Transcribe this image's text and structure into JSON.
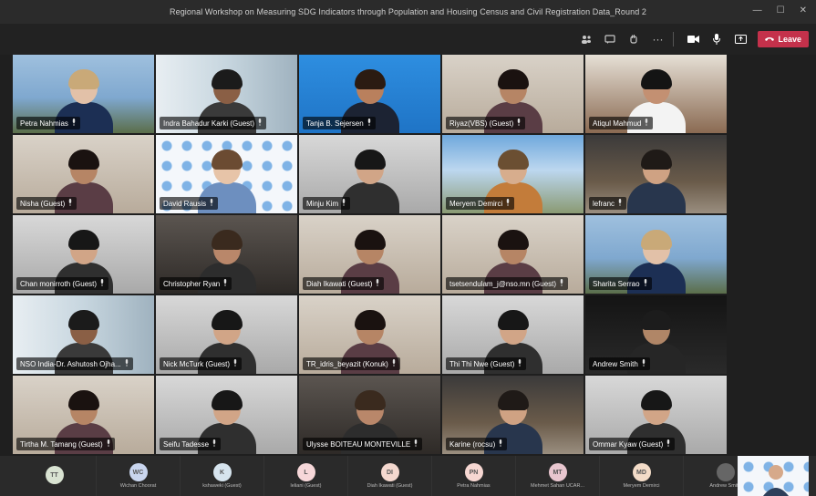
{
  "window": {
    "title": "Regional Workshop on Measuring SDG Indicators through Population and Housing Census and Civil Registration Data_Round 2",
    "minimize": "—",
    "maximize": "☐",
    "close": "✕"
  },
  "toolbar": {
    "leave_label": "Leave",
    "more": "···"
  },
  "tiles": [
    {
      "name": "Petra Nahmias",
      "theme": "escap"
    },
    {
      "name": "Indra Bahadur Karki (Guest)",
      "theme": "window"
    },
    {
      "name": "Tanja B. Sejersen",
      "theme": "blue"
    },
    {
      "name": "Riyaz(VBS) (Guest)",
      "theme": "room"
    },
    {
      "name": "Atiqul Mahmud",
      "theme": "wood"
    },
    {
      "name": "Nisha (Guest)",
      "theme": "room"
    },
    {
      "name": "David Rausis",
      "theme": "un"
    },
    {
      "name": "Minju Kim",
      "theme": "grey"
    },
    {
      "name": "Meryem Demirci",
      "theme": "city"
    },
    {
      "name": "lefranc",
      "theme": "shelf"
    },
    {
      "name": "Chan monirroth (Guest)",
      "theme": "grey"
    },
    {
      "name": "Christopher Ryan",
      "theme": "dark"
    },
    {
      "name": "Diah Ikawati (Guest)",
      "theme": "room"
    },
    {
      "name": "tsetsendulam_j@nso.mn (Guest)",
      "theme": "room"
    },
    {
      "name": "Sharita Serrao",
      "theme": "escap"
    },
    {
      "name": "NSO India-Dr. Ashutosh Ojha...",
      "theme": "window"
    },
    {
      "name": "Nick McTurk (Guest)",
      "theme": "grey"
    },
    {
      "name": "TR_idris_beyazit (Konuk)",
      "theme": "room"
    },
    {
      "name": "Thi Thi Nwe (Guest)",
      "theme": "grey"
    },
    {
      "name": "Andrew Smith",
      "theme": "black"
    },
    {
      "name": "Tirtha M. Tamang (Guest)",
      "theme": "room"
    },
    {
      "name": "Seifu Tadesse",
      "theme": "grey"
    },
    {
      "name": "Ulysse BOITEAU MONTEVILLE",
      "theme": "dark"
    },
    {
      "name": "Karine (rocsu)",
      "theme": "shelf"
    },
    {
      "name": "Ommar Kyaw (Guest)",
      "theme": "grey"
    }
  ],
  "participants": [
    {
      "initials": "TT",
      "name": "",
      "color": "#d9e3d2"
    },
    {
      "initials": "WC",
      "name": "Wichan Choorat",
      "color": "#c9d5ee"
    },
    {
      "initials": "K",
      "name": "kshaweki (Guest)",
      "color": "#d6e4ee"
    },
    {
      "initials": "L",
      "name": "leliani (Guest)",
      "color": "#f6d7d9"
    },
    {
      "initials": "DI",
      "name": "Diah Ikawati (Guest)",
      "color": "#f4d8cf"
    },
    {
      "initials": "PN",
      "name": "Petra Nahmias",
      "color": "#f6d7d2"
    },
    {
      "initials": "MT",
      "name": "Mehmet Sahan UCAR...",
      "color": "#e8c6cf"
    },
    {
      "initials": "MD",
      "name": "Meryem Demirci",
      "color": "#f3dcc8"
    },
    {
      "initials": "",
      "name": "Andrew Smith",
      "color": "#666666"
    }
  ]
}
